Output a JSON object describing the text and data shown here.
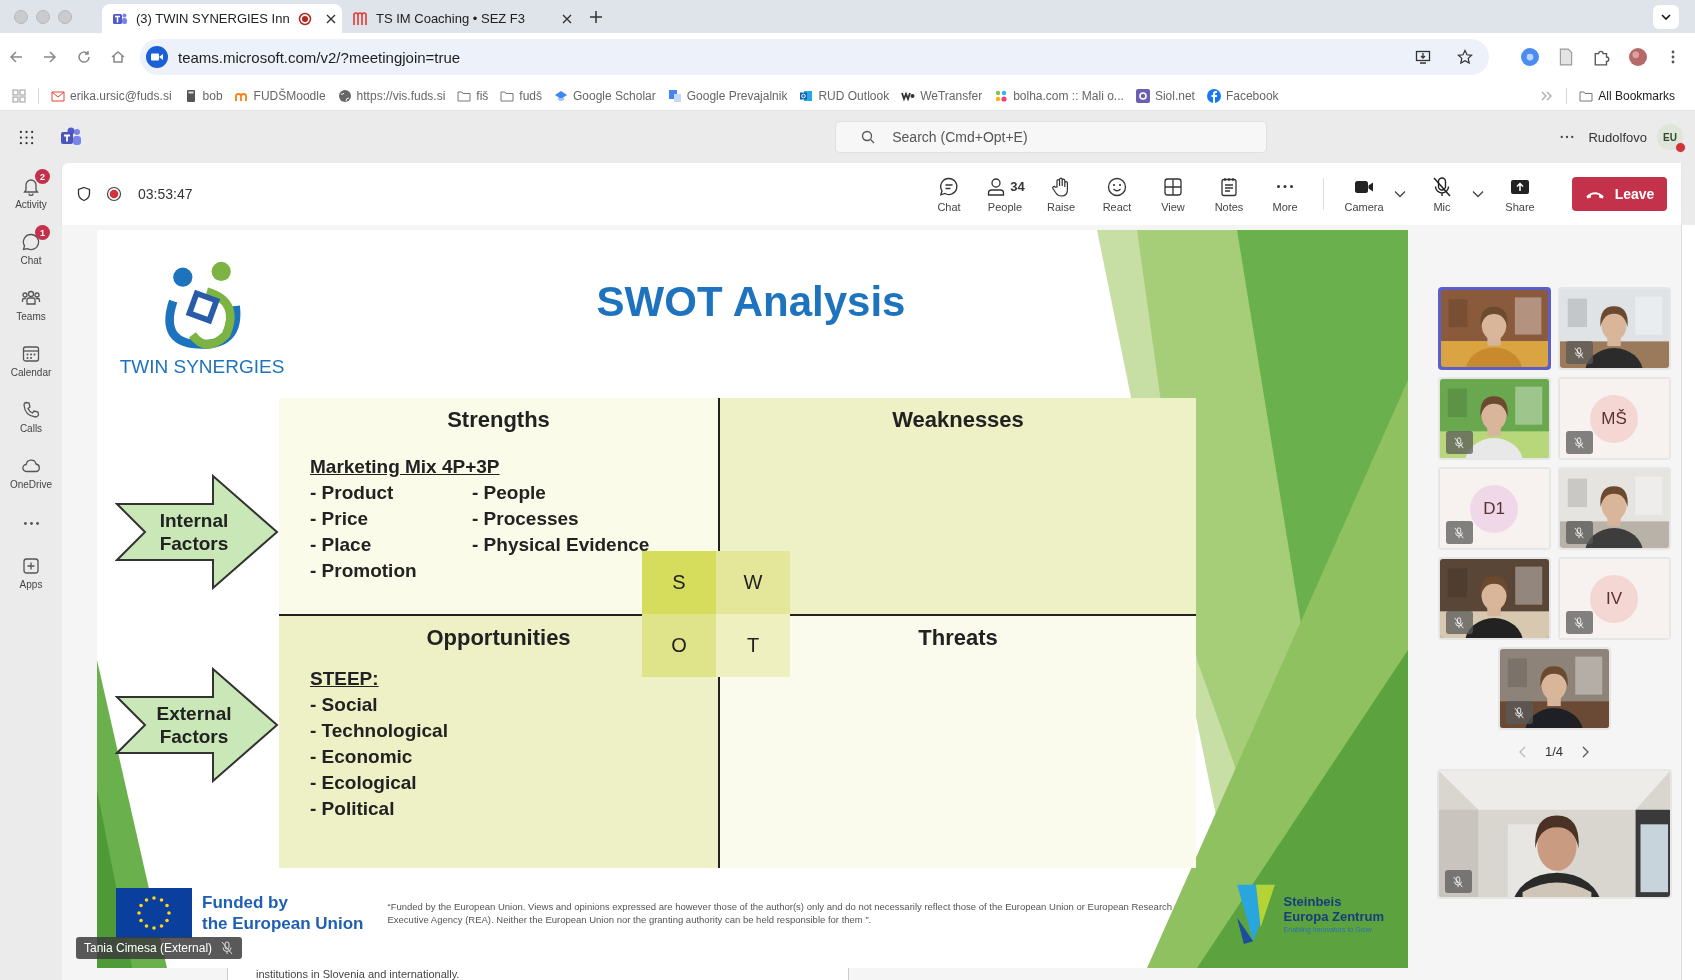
{
  "browser": {
    "tabs": [
      {
        "title": "(3) TWIN SYNERGIES Inn",
        "kind": "teams",
        "recording": true,
        "selected": true
      },
      {
        "title": "TS IM Coaching • SEZ F3",
        "kind": "meet",
        "recording": false,
        "selected": false
      }
    ],
    "url": "teams.microsoft.com/v2/?meetingjoin=true",
    "bookmarks": [
      {
        "label": "erika.ursic@fuds.si",
        "kind": "mail"
      },
      {
        "label": "bob",
        "kind": "calc"
      },
      {
        "label": "FUDŠMoodle",
        "kind": "moodle"
      },
      {
        "label": "https://vis.fuds.si",
        "kind": "globe"
      },
      {
        "label": "fiš",
        "kind": "folder"
      },
      {
        "label": "fudš",
        "kind": "folder"
      },
      {
        "label": "Google Scholar",
        "kind": "scholar"
      },
      {
        "label": "Google Prevajalnik",
        "kind": "translate"
      },
      {
        "label": "RUD Outlook",
        "kind": "outlook"
      },
      {
        "label": "WeTransfer",
        "kind": "we"
      },
      {
        "label": "bolha.com :: Mali o...",
        "kind": "dots"
      },
      {
        "label": "Siol.net",
        "kind": "siol"
      },
      {
        "label": "Facebook",
        "kind": "facebook"
      }
    ],
    "all_bookmarks": "All Bookmarks"
  },
  "teams": {
    "search": {
      "placeholder": "Search (Cmd+Opt+E)"
    },
    "org": "Rudolfovo",
    "avatar": "EU",
    "sidebar": [
      {
        "label": "Activity",
        "kind": "bell",
        "badge": "2"
      },
      {
        "label": "Chat",
        "kind": "chat",
        "badge": "1"
      },
      {
        "label": "Teams",
        "kind": "teams"
      },
      {
        "label": "Calendar",
        "kind": "calendar"
      },
      {
        "label": "Calls",
        "kind": "phone"
      },
      {
        "label": "OneDrive",
        "kind": "cloud"
      },
      {
        "kind": "more"
      },
      {
        "label": "Apps",
        "kind": "apps"
      }
    ]
  },
  "meeting": {
    "timer": "03:53:47",
    "recording": true,
    "actions": [
      {
        "label": "Chat",
        "kind": "chat"
      },
      {
        "label": "People",
        "kind": "people",
        "count": "34"
      },
      {
        "label": "Raise",
        "kind": "hand"
      },
      {
        "label": "React",
        "kind": "smile"
      },
      {
        "label": "View",
        "kind": "grid"
      },
      {
        "label": "Notes",
        "kind": "notes"
      },
      {
        "label": "More",
        "kind": "more"
      }
    ],
    "devices": [
      {
        "label": "Camera",
        "kind": "camera",
        "muted": false
      },
      {
        "label": "Mic",
        "kind": "mic",
        "muted": true
      },
      {
        "label": "Share",
        "kind": "share"
      }
    ],
    "leave": "Leave",
    "presenter": "Tania Cimesa (External)",
    "participants": [
      {
        "kind": "video",
        "muted": false,
        "selected": true
      },
      {
        "kind": "video",
        "muted": true,
        "selected": false
      },
      {
        "kind": "video",
        "muted": true,
        "selected": false
      },
      {
        "kind": "avatar",
        "initials": "MŠ",
        "color": "#f4d7d3",
        "muted": true,
        "selected": false
      },
      {
        "kind": "avatar",
        "initials": "D1",
        "color": "#f0d8e8",
        "muted": true,
        "selected": false
      },
      {
        "kind": "video",
        "muted": true,
        "selected": false
      },
      {
        "kind": "video",
        "muted": true,
        "selected": false
      },
      {
        "kind": "avatar",
        "initials": "IV",
        "color": "#f4d7d3",
        "muted": true,
        "selected": false
      },
      {
        "kind": "video",
        "muted": true,
        "selected": false
      }
    ],
    "pager": "1/4",
    "spotlight": {
      "muted": true
    },
    "document_line": "institutions in Slovenia and internationally."
  },
  "slide": {
    "logo_text": "TWIN SYNERGIES",
    "title": "SWOT Analysis",
    "factors": [
      "Internal Factors",
      "External Factors"
    ],
    "quadrants": [
      {
        "title": "Strengths",
        "heading": "Marketing Mix 4P+3P",
        "columns": [
          [
            "- Product",
            "- Price",
            "- Place",
            "- Promotion"
          ],
          [
            "- People",
            "- Processes",
            "- Physical Evidence"
          ]
        ],
        "color": "#fbfbea"
      },
      {
        "title": "Weaknesses",
        "color": "#eef0c6"
      },
      {
        "title": "Opportunities",
        "heading": "STEEP:",
        "columns": [
          [
            "- Social",
            "- Technological",
            "- Economic",
            "- Ecological",
            "- Political"
          ]
        ],
        "color": "#eef0c6"
      },
      {
        "title": "Threats",
        "color": "#fafbec"
      }
    ],
    "letters": [
      {
        "text": "S",
        "color": "#d6dc5c"
      },
      {
        "text": "W",
        "color": "#e4e79a"
      },
      {
        "text": "O",
        "color": "#dfe38a"
      },
      {
        "text": "T",
        "color": "#eef0c0"
      }
    ],
    "funded": [
      "Funded by",
      "the European Union"
    ],
    "disclaimer": "“Funded by the European Union. Views and opinions expressed are however those of the author(s) only and do not necessarily reflect those of the European Union or European Research Executive Agency (REA). Neither the European Union nor the granting authority can be held responsible for them ”.",
    "partner": [
      "Steinbeis",
      "Europa Zentrum"
    ],
    "partner_tagline": "Enabling Innovators to Grow"
  }
}
